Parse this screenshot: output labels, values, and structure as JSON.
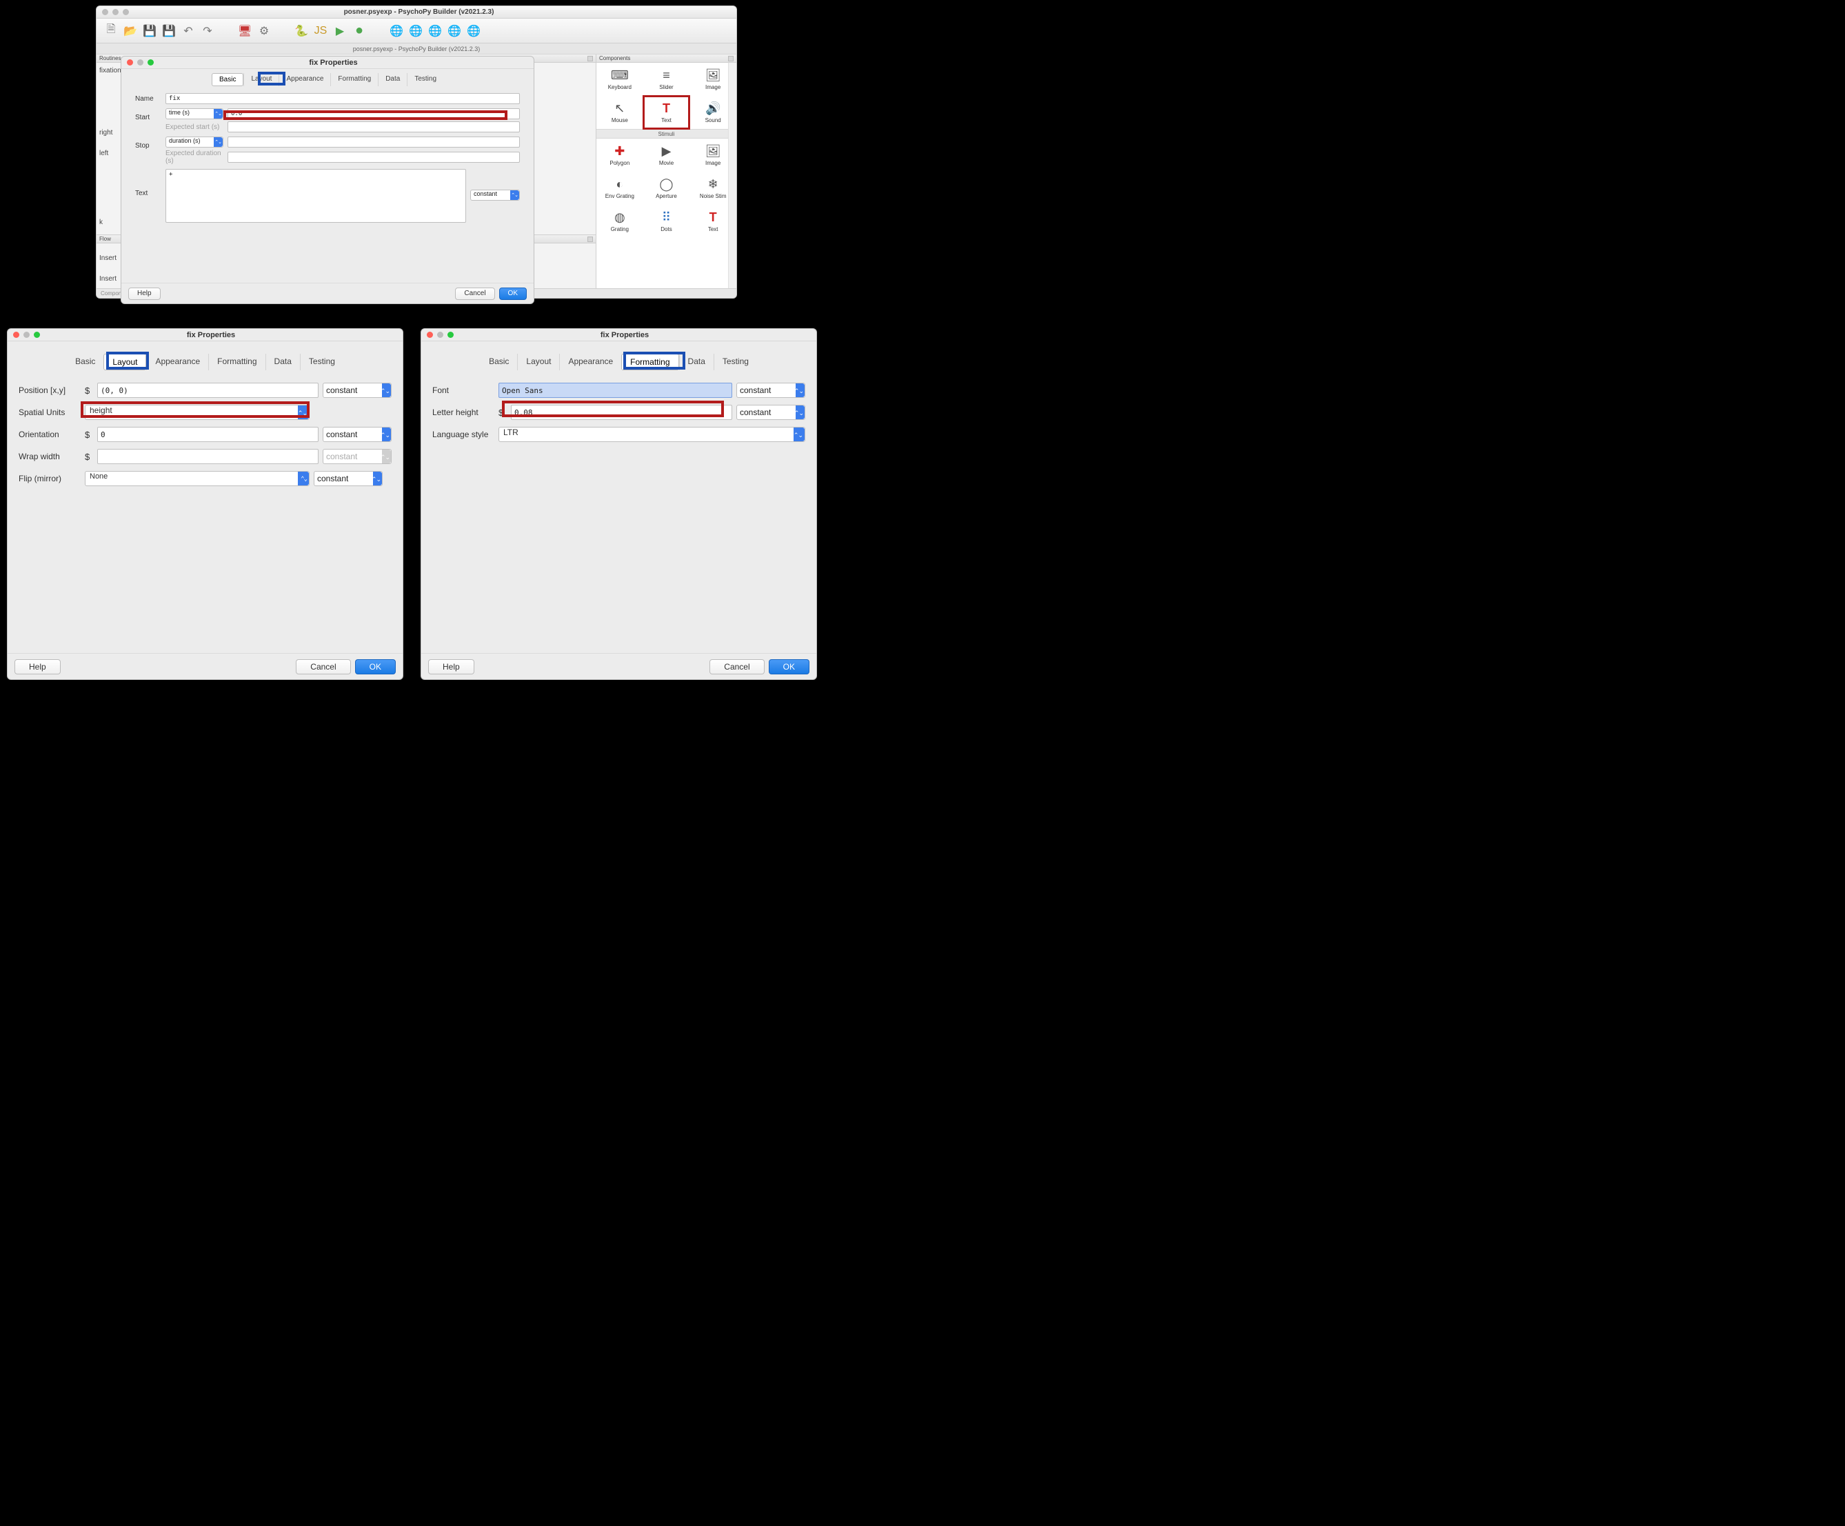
{
  "builder": {
    "title": "posner.psyexp - PsychoPy Builder (v2021.2.3)",
    "subtitle": "posner.psyexp - PsychoPy Builder (v2021.2.3)",
    "routines_header": "Routines",
    "components_header": "Components",
    "flow_header": "Flow",
    "status": "Component: fix",
    "canvas_labels": {
      "fixation": "fixation",
      "right": "right",
      "left": "left",
      "k": "k"
    },
    "flow_labels": {
      "insert1": "Insert",
      "insert2": "Insert"
    },
    "components": {
      "stimuli_header": "Stimuli",
      "items_top": [
        {
          "name": "Keyboard",
          "glyph": "⌨"
        },
        {
          "name": "Slider",
          "glyph": "≡"
        },
        {
          "name": "Image",
          "glyph": "🖼"
        },
        {
          "name": "Mouse",
          "glyph": "↖"
        },
        {
          "name": "Text",
          "glyph": "T"
        },
        {
          "name": "Sound",
          "glyph": "🔊"
        }
      ],
      "items_stim": [
        {
          "name": "Polygon",
          "glyph": "✚"
        },
        {
          "name": "Movie",
          "glyph": "▶"
        },
        {
          "name": "Image",
          "glyph": "🖼"
        },
        {
          "name": "Env Grating",
          "glyph": "◐"
        },
        {
          "name": "Aperture",
          "glyph": "◯"
        },
        {
          "name": "Noise Stim",
          "glyph": "❄"
        },
        {
          "name": "Grating",
          "glyph": "◍"
        },
        {
          "name": "Dots",
          "glyph": "⠿"
        },
        {
          "name": "Text",
          "glyph": "T"
        }
      ]
    }
  },
  "top_dialog": {
    "title": "fix Properties",
    "tabs": [
      "Basic",
      "Layout",
      "Appearance",
      "Formatting",
      "Data",
      "Testing"
    ],
    "fields": {
      "name_label": "Name",
      "name_value": "fix",
      "start_label": "Start",
      "start_unit": "time (s)",
      "start_value": "0.0",
      "expected_start": "Expected start (s)",
      "stop_label": "Stop",
      "stop_unit": "duration (s)",
      "expected_duration": "Expected duration (s)",
      "text_label": "Text",
      "text_value": "+",
      "constant": "constant"
    },
    "help": "Help",
    "cancel": "Cancel",
    "ok": "OK"
  },
  "bot_left": {
    "title": "fix Properties",
    "tabs": [
      "Basic",
      "Layout",
      "Appearance",
      "Formatting",
      "Data",
      "Testing"
    ],
    "fields": {
      "position_label": "Position [x,y]",
      "position_value": "(0, 0)",
      "units_label": "Spatial Units",
      "units_value": "height",
      "orientation_label": "Orientation",
      "orientation_value": "0",
      "wrap_label": "Wrap width",
      "wrap_value": "",
      "flip_label": "Flip (mirror)",
      "flip_value": "None",
      "constant": "constant"
    },
    "help": "Help",
    "cancel": "Cancel",
    "ok": "OK"
  },
  "bot_right": {
    "title": "fix Properties",
    "tabs": [
      "Basic",
      "Layout",
      "Appearance",
      "Formatting",
      "Data",
      "Testing"
    ],
    "fields": {
      "font_label": "Font",
      "font_value": "Open Sans",
      "letterh_label": "Letter height",
      "letterh_value": "0.08",
      "lang_label": "Language style",
      "lang_value": "LTR",
      "constant": "constant"
    },
    "help": "Help",
    "cancel": "Cancel",
    "ok": "OK"
  }
}
